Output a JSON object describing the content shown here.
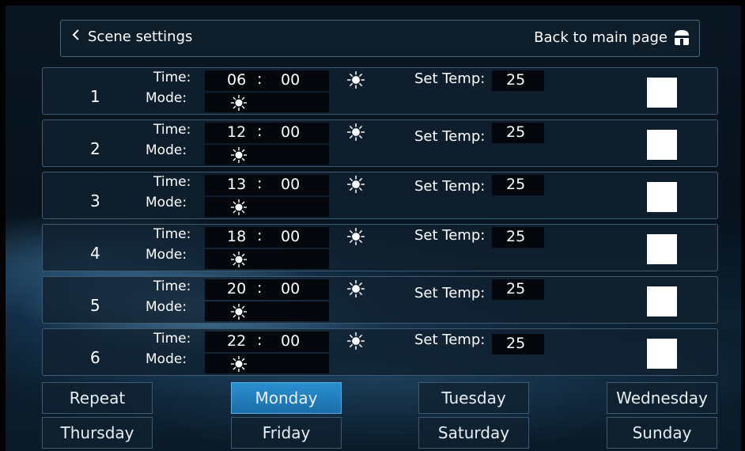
{
  "header": {
    "back_label": "Scene settings",
    "main_page_label": "Back to main page"
  },
  "scenes": [
    {
      "num": "1",
      "time_label": "Time:",
      "mode_label": "Mode:",
      "hour": "06",
      "sep": ":",
      "minute": "00",
      "set_temp_label": "Set Temp:",
      "temp": "25",
      "mode_icon": "sun-icon",
      "checked": false
    },
    {
      "num": "2",
      "time_label": "Time:",
      "mode_label": "Mode:",
      "hour": "12",
      "sep": ":",
      "minute": "00",
      "set_temp_label": "Set Temp:",
      "temp": "25",
      "mode_icon": "sun-icon",
      "checked": false
    },
    {
      "num": "3",
      "time_label": "Time:",
      "mode_label": "Mode:",
      "hour": "13",
      "sep": ":",
      "minute": "00",
      "set_temp_label": "Set Temp:",
      "temp": "25",
      "mode_icon": "sun-icon",
      "checked": false
    },
    {
      "num": "4",
      "time_label": "Time:",
      "mode_label": "Mode:",
      "hour": "18",
      "sep": ":",
      "minute": "00",
      "set_temp_label": "Set Temp:",
      "temp": "25",
      "mode_icon": "sun-icon",
      "checked": false
    },
    {
      "num": "5",
      "time_label": "Time:",
      "mode_label": "Mode:",
      "hour": "20",
      "sep": ":",
      "minute": "00",
      "set_temp_label": "Set Temp:",
      "temp": "25",
      "mode_icon": "sun-icon",
      "checked": false
    },
    {
      "num": "6",
      "time_label": "Time:",
      "mode_label": "Mode:",
      "hour": "22",
      "sep": ":",
      "minute": "00",
      "set_temp_label": "Set Temp:",
      "temp": "25",
      "mode_icon": "sun-icon",
      "checked": false
    }
  ],
  "days": {
    "repeat": "Repeat",
    "monday": "Monday",
    "tuesday": "Tuesday",
    "wednesday": "Wednesday",
    "thursday": "Thursday",
    "friday": "Friday",
    "saturday": "Saturday",
    "sunday": "Sunday",
    "selected": "Monday"
  },
  "colors": {
    "accent": "#2a8fd0",
    "panel_border": "#3e5a70",
    "checkbox": "#ffffff"
  }
}
